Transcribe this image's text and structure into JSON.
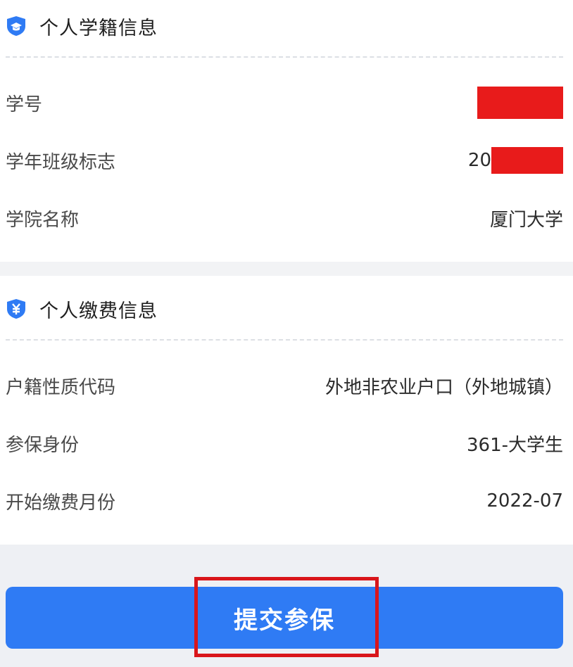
{
  "student_section": {
    "title": "个人学籍信息",
    "icon": "graduation-shield-icon",
    "rows": [
      {
        "label": "学号",
        "value": "",
        "redacted": true
      },
      {
        "label": "学年班级标志",
        "value": "20",
        "redacted": true
      },
      {
        "label": "学院名称",
        "value": "厦门大学",
        "redacted": false
      }
    ]
  },
  "payment_section": {
    "title": "个人缴费信息",
    "icon": "yuan-shield-icon",
    "rows": [
      {
        "label": "户籍性质代码",
        "value": "外地非农业户口（外地城镇）"
      },
      {
        "label": "参保身份",
        "value": "361-大学生"
      },
      {
        "label": "开始缴费月份",
        "value": "2022-07"
      }
    ]
  },
  "actions": {
    "submit_label": "提交参保"
  },
  "colors": {
    "accent": "#2f7bf4",
    "redaction": "#e81b1b",
    "highlight": "#d9161b"
  }
}
